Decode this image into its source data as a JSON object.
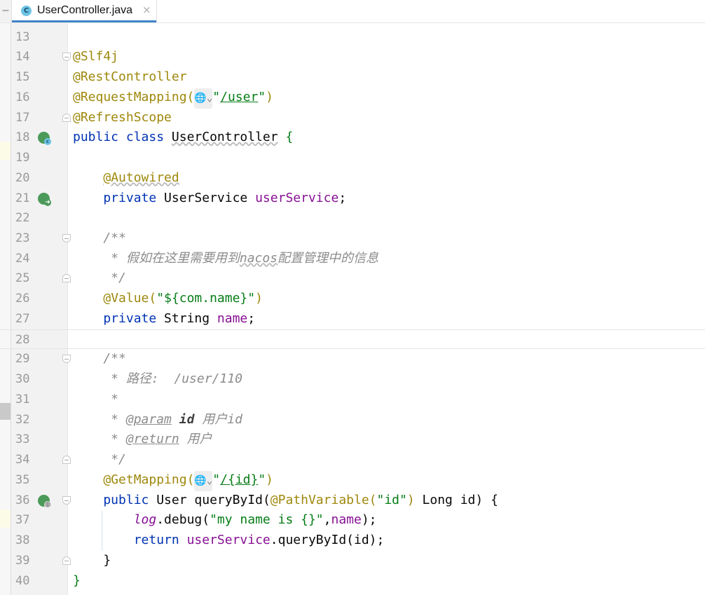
{
  "tab": {
    "icon_letter": "C",
    "title": "UserController.java",
    "close": "×",
    "collapse": "–"
  },
  "lines": [
    {
      "n": "13",
      "tokens": []
    },
    {
      "n": "14",
      "fold": "start",
      "tokens": [
        [
          "@Slf4j",
          "ann"
        ]
      ]
    },
    {
      "n": "15",
      "tokens": [
        [
          "@RestController",
          "ann"
        ]
      ]
    },
    {
      "n": "16",
      "tokens": [
        [
          "@RequestMapping(",
          "ann"
        ],
        [
          "🌐⌄",
          "globe"
        ],
        [
          "\"",
          "str"
        ],
        [
          "/user",
          "url"
        ],
        [
          "\"",
          "str"
        ],
        [
          ")",
          "ann"
        ]
      ]
    },
    {
      "n": "17",
      "fold": "end",
      "tokens": [
        [
          "@RefreshScope",
          "ann"
        ]
      ]
    },
    {
      "n": "18",
      "gutter_icon": "bean-class",
      "tokens": [
        [
          "public class ",
          "kw"
        ],
        [
          "UserController",
          "wavy"
        ],
        [
          " ",
          ""
        ],
        [
          "{",
          "brace"
        ]
      ]
    },
    {
      "n": "19",
      "tokens": []
    },
    {
      "n": "20",
      "tokens": [
        [
          "    ",
          ""
        ],
        [
          "@Autowired",
          "annwavy"
        ]
      ]
    },
    {
      "n": "21",
      "gutter_icon": "bean-injected",
      "tokens": [
        [
          "    private ",
          "kw"
        ],
        [
          "UserService ",
          ""
        ],
        [
          "userService",
          "fld"
        ],
        [
          ";",
          ""
        ]
      ]
    },
    {
      "n": "22",
      "tokens": []
    },
    {
      "n": "23",
      "fold": "start",
      "tokens": [
        [
          "    /**",
          "cm"
        ]
      ]
    },
    {
      "n": "24",
      "tokens": [
        [
          "     * 假如在这里需要用到",
          "cm"
        ],
        [
          "nacos",
          "cm wavy"
        ],
        [
          "配置管理中的信息",
          "cm"
        ]
      ]
    },
    {
      "n": "25",
      "fold": "end",
      "tokens": [
        [
          "     */",
          "cm"
        ]
      ]
    },
    {
      "n": "26",
      "tokens": [
        [
          "    ",
          ""
        ],
        [
          "@Value(",
          "ann"
        ],
        [
          "\"${com.name}\"",
          "str"
        ],
        [
          ")",
          "ann"
        ]
      ]
    },
    {
      "n": "27",
      "tokens": [
        [
          "    private ",
          "kw"
        ],
        [
          "String ",
          ""
        ],
        [
          "name",
          "fld"
        ],
        [
          ";",
          ""
        ]
      ]
    },
    {
      "n": "28",
      "current": true,
      "tokens": []
    },
    {
      "n": "29",
      "fold": "start",
      "tokens": [
        [
          "    /**",
          "cm"
        ]
      ]
    },
    {
      "n": "30",
      "tokens": [
        [
          "     * 路径:  /user/110",
          "cm"
        ]
      ]
    },
    {
      "n": "31",
      "tokens": [
        [
          "     *",
          "cm"
        ]
      ]
    },
    {
      "n": "32",
      "tokens": [
        [
          "     * ",
          "cm"
        ],
        [
          "@param",
          "cmtag"
        ],
        [
          " ",
          ""
        ],
        [
          "id",
          "cmid"
        ],
        [
          " 用户id",
          "cm"
        ]
      ]
    },
    {
      "n": "33",
      "tokens": [
        [
          "     * ",
          "cm"
        ],
        [
          "@return",
          "cmtag"
        ],
        [
          " 用户",
          "cm"
        ]
      ]
    },
    {
      "n": "34",
      "fold": "end",
      "tokens": [
        [
          "     */",
          "cm"
        ]
      ]
    },
    {
      "n": "35",
      "tokens": [
        [
          "    ",
          ""
        ],
        [
          "@GetMapping(",
          "ann"
        ],
        [
          "🌐⌄",
          "globe"
        ],
        [
          "\"",
          "str"
        ],
        [
          "/{id}",
          "url"
        ],
        [
          "\"",
          "str"
        ],
        [
          ")",
          "ann"
        ]
      ]
    },
    {
      "n": "36",
      "fold": "start",
      "gutter_icon": "web-endpoint",
      "tokens": [
        [
          "    public ",
          "kw"
        ],
        [
          "User ",
          ""
        ],
        [
          "queryById(",
          ""
        ],
        [
          "@PathVariable(",
          "ann"
        ],
        [
          "\"id\"",
          "str"
        ],
        [
          ")",
          "ann"
        ],
        [
          " Long id) {",
          ""
        ]
      ]
    },
    {
      "n": "37",
      "tokens": [
        [
          "        ",
          ""
        ],
        [
          "log",
          "fldi"
        ],
        [
          ".debug(",
          ""
        ],
        [
          "\"my name is {}\"",
          "str"
        ],
        [
          ",",
          ""
        ],
        [
          "name",
          "fld"
        ],
        [
          ");",
          ""
        ]
      ]
    },
    {
      "n": "38",
      "tokens": [
        [
          "        return ",
          "kw"
        ],
        [
          "userService",
          "fld"
        ],
        [
          ".queryById(id);",
          ""
        ]
      ]
    },
    {
      "n": "39",
      "fold": "end",
      "tokens": [
        [
          "    }",
          ""
        ]
      ]
    },
    {
      "n": "40",
      "tokens": [
        [
          "}",
          "brace"
        ]
      ]
    }
  ],
  "colors": {
    "annotation": "#9e880d",
    "keyword": "#0033b3",
    "string": "#067d17",
    "field": "#871094",
    "comment": "#8c8c8c",
    "tab_accent": "#4083c9"
  }
}
